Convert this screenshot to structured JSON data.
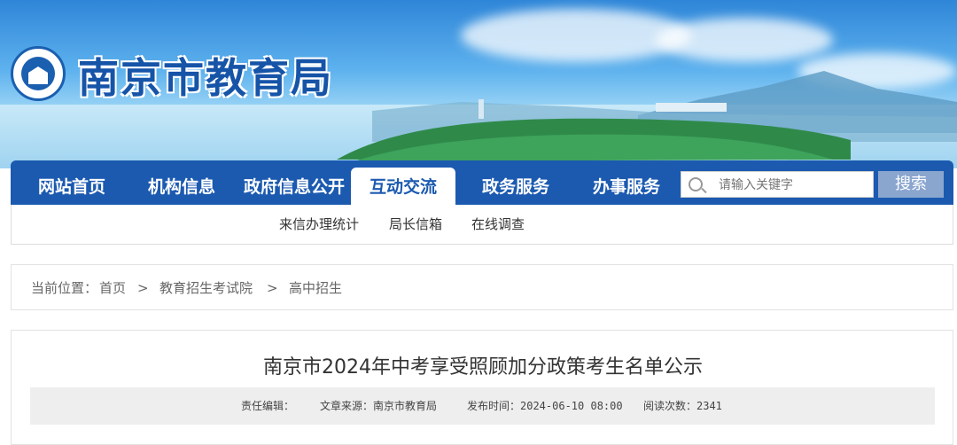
{
  "header": {
    "site_title": "南京市教育局"
  },
  "nav": {
    "items": [
      "网站首页",
      "机构信息",
      "政府信息公开",
      "互动交流",
      "政务服务",
      "办事服务"
    ],
    "search_placeholder": "请输入关键字",
    "search_button": "搜索"
  },
  "subnav": {
    "items": [
      "来信办理统计",
      "局长信箱",
      "在线调查"
    ]
  },
  "breadcrumb": {
    "label": "当前位置：",
    "items": [
      "首页",
      "教育招生考试院",
      "高中招生"
    ],
    "separator": ">"
  },
  "article": {
    "title": "南京市2024年中考享受照顾加分政策考生名单公示",
    "editor_label": "责任编辑：",
    "source": "文章来源：南京市教育局",
    "publish_time": "发布时间：2024-06-10 08:00",
    "read_count": "阅读次数：2341"
  },
  "colors": {
    "nav_blue": "#1c5ab0",
    "title_blue": "#1654a8",
    "search_button": "#8aa6cf"
  }
}
